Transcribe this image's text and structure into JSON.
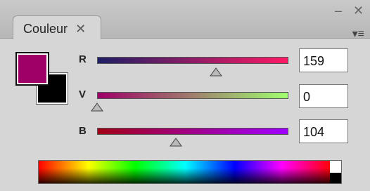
{
  "window": {
    "tab_label": "Couleur",
    "close_glyph": "✕",
    "minimize_glyph": "–",
    "window_close_glyph": "✕",
    "menu_glyph": "▾≡"
  },
  "swatches": {
    "fill_color": "#9f0068",
    "stroke_color": "#000000"
  },
  "sliders": [
    {
      "label": "R",
      "value": "159",
      "fraction": 0.62
    },
    {
      "label": "V",
      "value": "0",
      "fraction": 0.0
    },
    {
      "label": "B",
      "value": "104",
      "fraction": 0.41
    }
  ]
}
